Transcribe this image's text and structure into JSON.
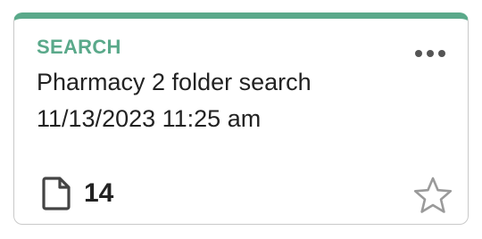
{
  "card": {
    "type_label": "SEARCH",
    "title": "Pharmacy 2 folder search",
    "timestamp": "11/13/2023 11:25 am",
    "document_count": "14",
    "document_icon": "document-icon",
    "favorite_icon": "star-outline-icon",
    "more_icon": "more-horizontal-icon",
    "accent_color": "#5aa98a",
    "favorited": false
  }
}
